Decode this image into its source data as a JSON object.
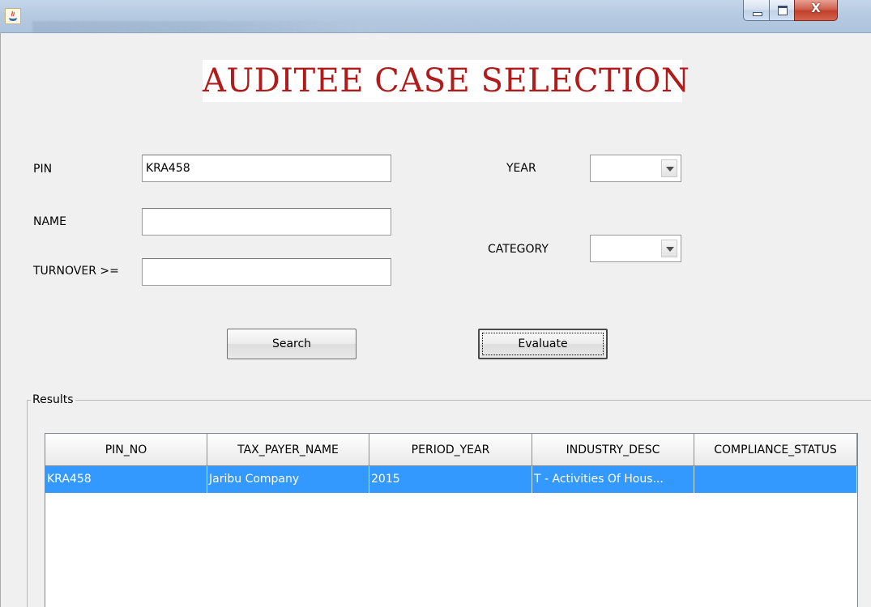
{
  "window": {
    "icon": "java-icon",
    "controls": {
      "close_label": "X"
    }
  },
  "title": "AUDITEE CASE SELECTION",
  "form": {
    "pin": {
      "label": "PIN",
      "value": "KRA458"
    },
    "name": {
      "label": "NAME",
      "value": ""
    },
    "turnover": {
      "label": "TURNOVER >=",
      "value": ""
    },
    "year": {
      "label": "YEAR",
      "selected": ""
    },
    "category": {
      "label": "CATEGORY",
      "selected": ""
    }
  },
  "buttons": {
    "search": "Search",
    "evaluate": "Evaluate"
  },
  "results": {
    "title": "Results",
    "columns": [
      "PIN_NO",
      "TAX_PAYER_NAME",
      "PERIOD_YEAR",
      "INDUSTRY_DESC",
      "COMPLIANCE_STATUS"
    ],
    "rows": [
      [
        "KRA458",
        "Jaribu Company",
        "2015",
        "T - Activities Of Hous...",
        ""
      ]
    ],
    "selected_row_color": "#3399ff"
  },
  "colors": {
    "title_text": "#b01c1c",
    "background": "#f0f0f0"
  }
}
